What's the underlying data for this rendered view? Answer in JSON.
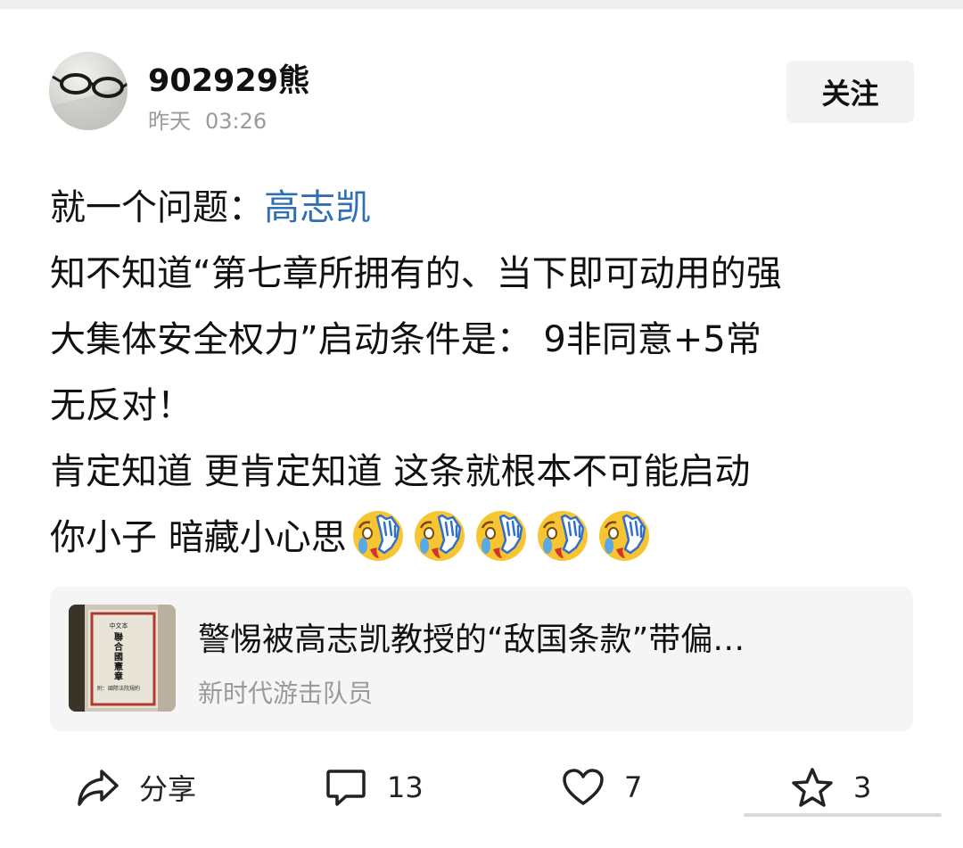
{
  "post": {
    "author": "902929熊",
    "time_day": "昨天",
    "time_clock": "03:26",
    "follow_label": "关注",
    "body": {
      "line1_prefix": "就一个问题：",
      "line1_mention": "高志凯",
      "line2": "知不知道“第七章所拥有的、当下即可动用的强",
      "line3": "大集体安全权力”启动条件是： 9非同意+5常",
      "line4": "无反对！",
      "line5": "肯定知道 更肯定知道 这条就根本不可能启动",
      "line6": "你小子 暗藏小心思",
      "emoji_count": 5,
      "emoji_icon": "facepalm-crying-emoji"
    }
  },
  "link_card": {
    "title": "警惕被高志凯教授的“敌国条款”带偏…",
    "source": "新时代游击队员",
    "thumb_text": {
      "small": "中文本",
      "main": "聯合國憲章",
      "sub": "附：國際法院規約"
    }
  },
  "actions": {
    "share": {
      "label": "分享",
      "icon": "share-arrow-icon"
    },
    "comment": {
      "count": "13",
      "icon": "comment-bubble-icon"
    },
    "like": {
      "count": "7",
      "icon": "heart-icon"
    },
    "star": {
      "count": "3",
      "icon": "star-icon"
    }
  },
  "colors": {
    "mention": "#2f6fb2",
    "meta_gray": "#9a9a9a",
    "card_bg": "#f5f5f5",
    "follow_bg": "#f3f3f3"
  }
}
